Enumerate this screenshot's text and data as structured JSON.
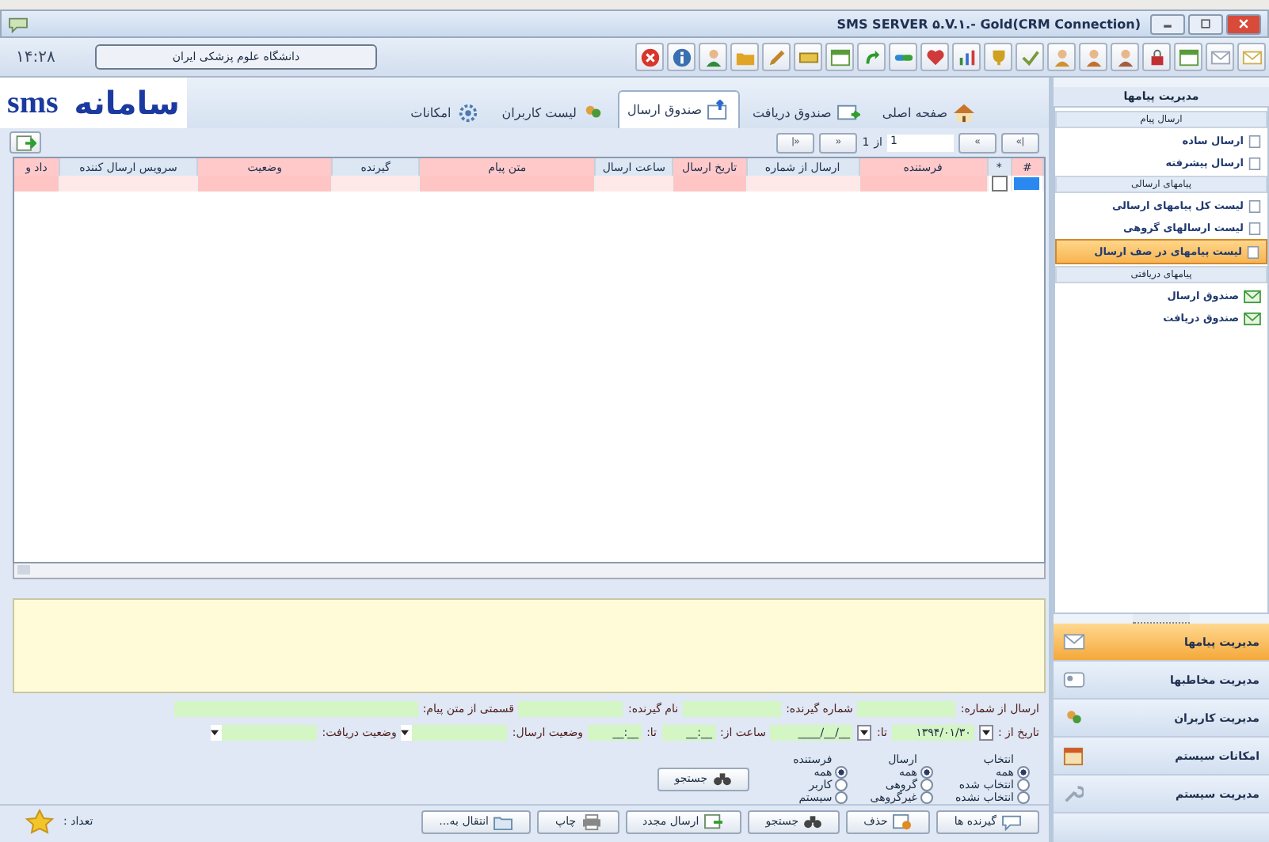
{
  "window": {
    "title": "SMS SERVER ۵.V.۱.- Gold(CRM Connection)"
  },
  "header": {
    "clock": "۱۴:۲۸",
    "organization": "دانشگاه علوم پزشکی ایران"
  },
  "logo": {
    "persian": "سامانه",
    "latin": "sms"
  },
  "tabs": [
    {
      "label": "صفحه اصلی",
      "selected": false
    },
    {
      "label": "صندوق دریافت",
      "selected": false
    },
    {
      "label": "صندوق ارسال",
      "selected": true
    },
    {
      "label": "لیست کاربران",
      "selected": false
    },
    {
      "label": "امکانات",
      "selected": false
    }
  ],
  "pager": {
    "buttons": [
      "|»",
      "»",
      "«",
      "«|"
    ],
    "page": "1",
    "of_label": "از",
    "total": "1"
  },
  "table": {
    "columns": [
      "#",
      "*",
      "فرستنده",
      "ارسال از شماره",
      "تاریخ ارسال",
      "ساعت ارسال",
      "متن پیام",
      "گیرنده",
      "وضعیت",
      "سرویس ارسال کننده",
      "داد و"
    ],
    "rows": [
      {
        "selected": true,
        "checked": false
      }
    ]
  },
  "filters": {
    "fields": [
      {
        "label": "ارسال از شماره:"
      },
      {
        "label": "شماره گیرنده:"
      },
      {
        "label": "نام گیرنده:"
      },
      {
        "label": "قسمتی از متن پیام:"
      }
    ],
    "date_from_label": "تاریخ از :",
    "date_from": "۱۳۹۴/۰۱/۳۰",
    "date_to_label": "تا:",
    "date_to": "__/__/____",
    "time_from_label": "ساعت از:",
    "time_from": "__:__",
    "time_to_label": "تا:",
    "time_to": "__:__",
    "send_status_label": "وضعیت ارسال:",
    "receive_status_label": "وضعیت دریافت:",
    "radio_groups": [
      {
        "title": "انتخاب",
        "options": [
          {
            "label": "همه",
            "selected": true
          },
          {
            "label": "انتخاب شده",
            "selected": false
          },
          {
            "label": "انتخاب نشده",
            "selected": false
          }
        ]
      },
      {
        "title": "ارسال",
        "options": [
          {
            "label": "همه",
            "selected": true
          },
          {
            "label": "گروهی",
            "selected": false
          },
          {
            "label": "غیرگروهی",
            "selected": false
          }
        ]
      },
      {
        "title": "فرستنده",
        "options": [
          {
            "label": "همه",
            "selected": true
          },
          {
            "label": "کاربر",
            "selected": false
          },
          {
            "label": "سیستم",
            "selected": false
          }
        ]
      }
    ],
    "search_button": "جستجو"
  },
  "actions": [
    "گیرنده ها",
    "حذف",
    "جستجو",
    "ارسال مجدد",
    "چاپ",
    "انتقال به..."
  ],
  "count_label": "تعداد :",
  "sidebar": {
    "title": "مدیریت پیامها",
    "groups": [
      {
        "title": "ارسال پیام",
        "items": [
          {
            "label": "ارسال ساده",
            "kind": "page",
            "selected": false
          },
          {
            "label": "ارسال پیشرفته",
            "kind": "page",
            "selected": false
          }
        ]
      },
      {
        "title": "پیامهای ارسالی",
        "items": [
          {
            "label": "لیست کل پیامهای ارسالی",
            "kind": "page",
            "selected": false
          },
          {
            "label": "لیست ارسالهای گروهی",
            "kind": "page",
            "selected": false
          },
          {
            "label": "لیست پیامهای در صف ارسال",
            "kind": "page",
            "selected": true
          }
        ]
      },
      {
        "title": "پیامهای دریافتی",
        "items": [
          {
            "label": "صندوق ارسال",
            "kind": "mail",
            "selected": false
          },
          {
            "label": "صندوق دریافت",
            "kind": "mail",
            "selected": false
          }
        ]
      }
    ],
    "nav": [
      {
        "label": "مدیریت پیامها",
        "selected": true
      },
      {
        "label": "مدیریت مخاطبها",
        "selected": false
      },
      {
        "label": "مدیریت کاربران",
        "selected": false
      },
      {
        "label": "امکانات سیستم",
        "selected": false
      },
      {
        "label": "مدیریت سیستم",
        "selected": false
      }
    ]
  }
}
